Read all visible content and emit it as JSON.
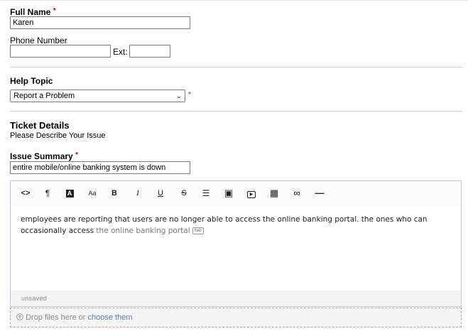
{
  "contact": {
    "full_name_label": "Full Name",
    "required_mark": "*",
    "full_name_value": "Karen",
    "phone_label": "Phone Number",
    "phone_value": "",
    "ext_label": "Ext:",
    "ext_value": ""
  },
  "help_topic": {
    "label": "Help Topic",
    "selected": "Report a Problem",
    "required_mark": "*"
  },
  "ticket": {
    "heading": "Ticket Details",
    "subheading": "Please Describe Your Issue",
    "summary_label": "Issue Summary",
    "required_mark": "*",
    "summary_value": "entire mobile/online banking system is down"
  },
  "editor": {
    "toolbar": [
      {
        "name": "code-view-icon",
        "glyph": "<>"
      },
      {
        "name": "paragraph-format-icon",
        "glyph": "¶"
      },
      {
        "name": "text-color-icon",
        "glyph": "A"
      },
      {
        "name": "font-size-icon",
        "glyph": "Aa"
      },
      {
        "name": "bold-icon",
        "glyph": "B"
      },
      {
        "name": "italic-icon",
        "glyph": "I"
      },
      {
        "name": "underline-icon",
        "glyph": "U"
      },
      {
        "name": "strikethrough-icon",
        "glyph": "S"
      },
      {
        "name": "unordered-list-icon",
        "glyph": "☰"
      },
      {
        "name": "insert-image-icon",
        "glyph": "▣"
      },
      {
        "name": "insert-video-icon",
        "glyph": "▶"
      },
      {
        "name": "insert-table-icon",
        "glyph": "▦"
      },
      {
        "name": "insert-link-icon",
        "glyph": "∞"
      },
      {
        "name": "horizontal-rule-icon",
        "glyph": "—"
      }
    ],
    "body_text": "employees are reporting that users are no longer able to access the online banking portal. the ones who can occasionally access ",
    "body_suggestion": "the online banking portal",
    "suggestion_key": "tab",
    "status": "unsaved"
  },
  "attachments": {
    "icon": "upload-icon",
    "drop_text": "Drop files here or ",
    "choose_link": "choose them"
  }
}
